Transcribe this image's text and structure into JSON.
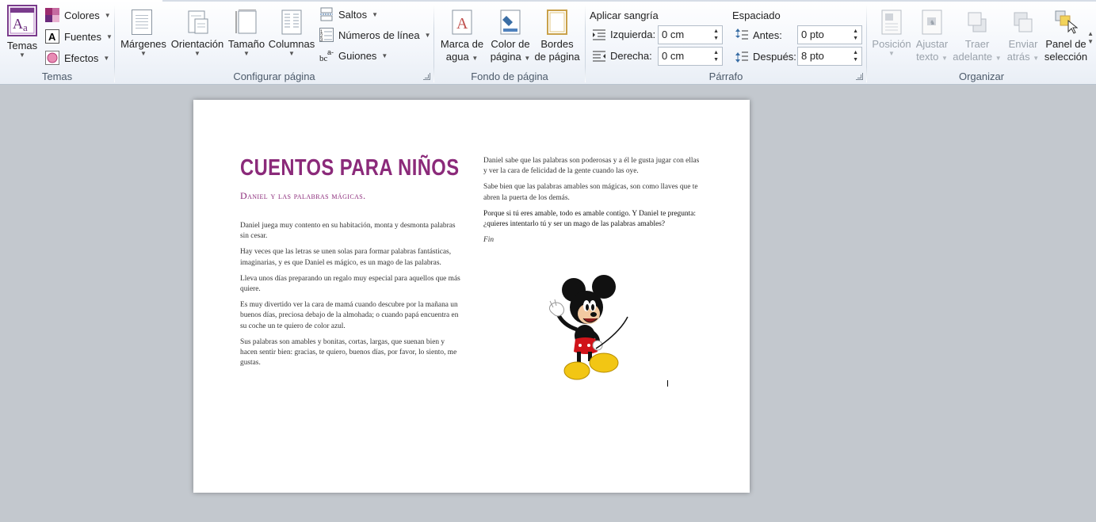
{
  "ribbon": {
    "temas": {
      "temas_label": "Temas",
      "colores_label": "Colores",
      "fuentes_label": "Fuentes",
      "efectos_label": "Efectos",
      "group_label": "Temas"
    },
    "configurar": {
      "margenes_label": "Márgenes",
      "orientacion_label": "Orientación",
      "tamano_label": "Tamaño",
      "columnas_label": "Columnas",
      "saltos_label": "Saltos",
      "numeros_label": "Números de línea",
      "guiones_label": "Guiones",
      "group_label": "Configurar página"
    },
    "fondo": {
      "marca_line1": "Marca de",
      "marca_line2": "agua",
      "color_line1": "Color de",
      "color_line2": "página",
      "bordes_line1": "Bordes",
      "bordes_line2": "de página",
      "group_label": "Fondo de página"
    },
    "parrafo": {
      "sangria_label": "Aplicar sangría",
      "izquierda_label": "Izquierda:",
      "izquierda_value": "0 cm",
      "derecha_label": "Derecha:",
      "derecha_value": "0 cm",
      "espaciado_label": "Espaciado",
      "antes_label": "Antes:",
      "antes_value": "0 pto",
      "despues_label": "Después:",
      "despues_value": "8 pto",
      "group_label": "Párrafo"
    },
    "organizar": {
      "posicion_label": "Posición",
      "ajustar_line1": "Ajustar",
      "ajustar_line2": "texto",
      "traer_line1": "Traer",
      "traer_line2": "adelante",
      "enviar_line1": "Enviar",
      "enviar_line2": "atrás",
      "panel_line1": "Panel de",
      "panel_line2": "selección",
      "group_label": "Organizar"
    }
  },
  "document": {
    "title": "CUENTOS PARA NIÑOS",
    "subtitle": "Daniel y las palabras mágicas.",
    "left_paragraphs": [
      "Daniel juega muy contento en su habitación, monta y desmonta palabras  sin cesar.",
      "Hay veces  que las letras  se unen solas para  formar palabras fantásticas, imaginarias, y es que Daniel es mágico, es un mago de las palabras.",
      "Lleva unos días preparando  un regalo  muy especial  para  aquellos que más quiere.",
      "Es muy divertido ver  la cara  de mamá cuando descubre por la mañana un buenos días, preciosa debajo de la almohada; o cuando papá encuentra  en su coche  un te quiero de color azul.",
      "Sus palabras  son amables  y bonitas, cortas, largas,  que suenan bien y hacen  sentir bien: gracias,  te quiero, buenos días, por favor, lo siento, me gustas."
    ],
    "right_paragraphs": [
      "Daniel sabe que las palabras  son poderosas  y a él le gusta jugar con ellas y ver  la cara  de felicidad de la gente cuando las oye.",
      "Sabe bien que las palabras  amables son mágicas, son como llaves que te abren la puerta de los demás.",
      "Porque si tú eres  amable, todo es amable contigo. Y Daniel  te pregunta: ¿quieres  intentarlo tú y ser un mago de las palabras amables?",
      "Fin"
    ]
  }
}
